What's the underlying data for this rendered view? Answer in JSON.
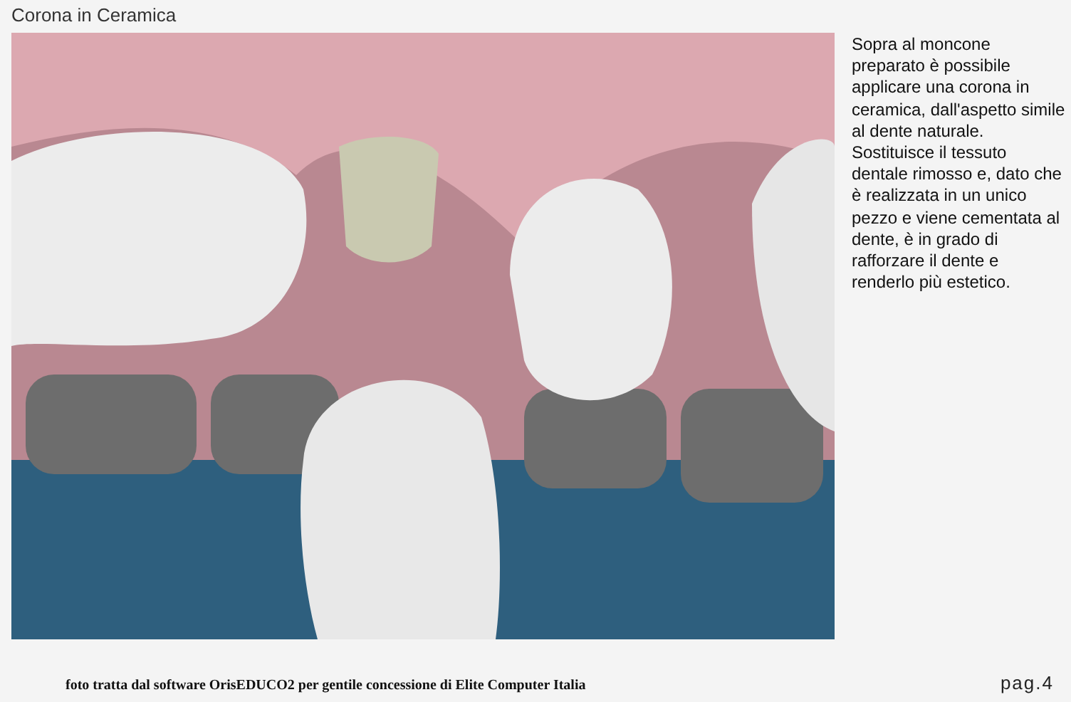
{
  "title": "Corona in Ceramica",
  "figure": {
    "description": "Sopra al moncone preparato è possibile applicare una corona in ceramica, dall'aspetto simile al dente naturale. Sostituisce il tessuto dentale rimosso e, dato che è realizzata in un unico pezzo e viene cementata al dente, è in grado di rafforzare il dente e renderlo più estetico."
  },
  "footer": {
    "caption": "foto tratta dal software OrisEDUCO2 per gentile concessione di Elite Computer Italia",
    "page": "pag.4"
  }
}
